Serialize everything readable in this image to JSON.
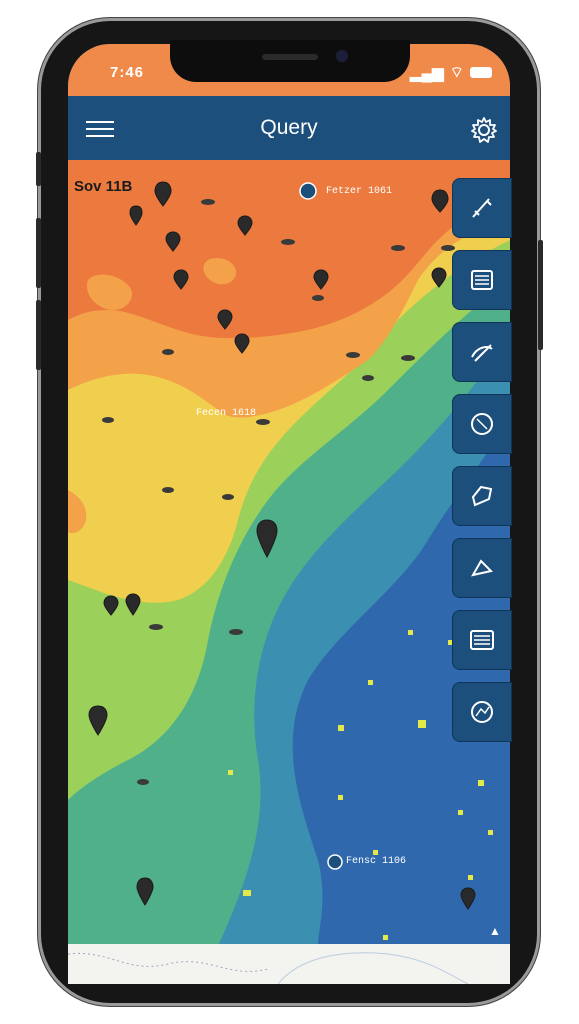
{
  "status": {
    "time": "7:46"
  },
  "header": {
    "title": "Query"
  },
  "map": {
    "corner_label": "Sov 11B",
    "labels": [
      "Fetzer 1061",
      "Fecen 1618",
      "Fensc 1106"
    ]
  },
  "toolbar": {
    "items": [
      "tool-draw",
      "tool-layers",
      "tool-measure",
      "tool-globe",
      "tool-shape",
      "tool-select",
      "tool-list",
      "tool-route"
    ]
  },
  "colors": {
    "header": "#1d4f7c",
    "status": "#f08a4a",
    "deep_water": "#2d63a8"
  }
}
